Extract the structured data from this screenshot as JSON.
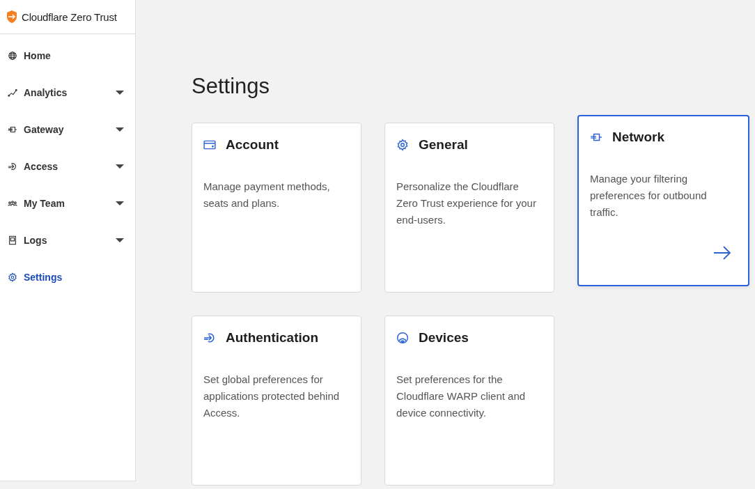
{
  "brand": {
    "name": "Cloudflare Zero Trust"
  },
  "sidebar": {
    "items": [
      {
        "label": "Home",
        "expandable": false,
        "selected": false
      },
      {
        "label": "Analytics",
        "expandable": true,
        "selected": false
      },
      {
        "label": "Gateway",
        "expandable": true,
        "selected": false
      },
      {
        "label": "Access",
        "expandable": true,
        "selected": false
      },
      {
        "label": "My Team",
        "expandable": true,
        "selected": false
      },
      {
        "label": "Logs",
        "expandable": true,
        "selected": false
      },
      {
        "label": "Settings",
        "expandable": false,
        "selected": true
      }
    ]
  },
  "page": {
    "title": "Settings"
  },
  "cards": [
    {
      "title": "Account",
      "description": "Manage payment methods, seats and plans.",
      "highlighted": false
    },
    {
      "title": "General",
      "description": "Personalize the Cloudflare Zero Trust experience for your end-users.",
      "highlighted": false
    },
    {
      "title": "Network",
      "description": "Manage your filtering preferences for outbound traffic.",
      "highlighted": true
    },
    {
      "title": "Authentication",
      "description": "Set global preferences for applications protected behind Access.",
      "highlighted": false
    },
    {
      "title": "Devices",
      "description": "Set preferences for the Cloudflare WARP client and device connectivity.",
      "highlighted": false
    }
  ]
}
